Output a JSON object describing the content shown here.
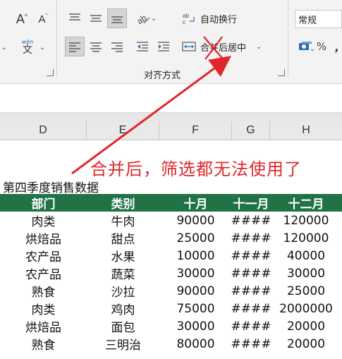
{
  "ribbon": {
    "wrap_text": "自动换行",
    "merge_center": "合并后居中",
    "alignment_group": "对齐方式",
    "number_format": "常规",
    "phonetic_top": "wén",
    "phonetic_bottom": "文",
    "increase_font": "A",
    "decrease_font": "A",
    "percent": "%",
    "comma": ","
  },
  "columns": [
    "D",
    "E",
    "F",
    "G",
    "H"
  ],
  "annotation": "合并后，筛选都无法使用了",
  "table": {
    "title": "第四季度销售数据",
    "headers": [
      "部门",
      "类别",
      "十月",
      "十一月",
      "十二月"
    ],
    "rows": [
      [
        "肉类",
        "牛肉",
        "90000",
        "####",
        "120000"
      ],
      [
        "烘焙品",
        "甜点",
        "25000",
        "####",
        "120000"
      ],
      [
        "农产品",
        "水果",
        "10000",
        "####",
        "40000"
      ],
      [
        "农产品",
        "蔬菜",
        "30000",
        "####",
        "30000"
      ],
      [
        "熟食",
        "沙拉",
        "90000",
        "####",
        "25000"
      ],
      [
        "肉类",
        "鸡肉",
        "75000",
        "####",
        "2000000"
      ],
      [
        "烘焙品",
        "面包",
        "30000",
        "####",
        "20000"
      ],
      [
        "熟食",
        "三明治",
        "80000",
        "####",
        "20000"
      ]
    ]
  },
  "colors": {
    "header_green": "#217346",
    "annotation_red": "#e0262b"
  }
}
